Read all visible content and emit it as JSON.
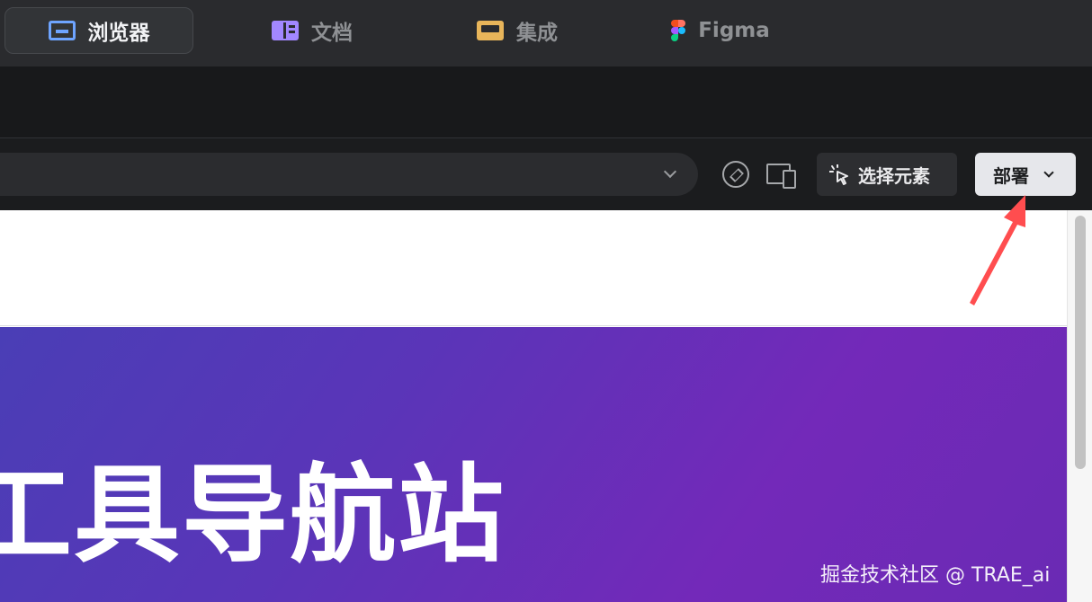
{
  "tabs": [
    {
      "label": "浏览器",
      "icon": "browser-icon",
      "active": true
    },
    {
      "label": "文档",
      "icon": "docs-icon",
      "active": false
    },
    {
      "label": "集成",
      "icon": "integration-icon",
      "active": false
    },
    {
      "label": "Figma",
      "icon": "figma-icon",
      "active": false
    }
  ],
  "toolbar": {
    "url_value": "",
    "select_element_label": "选择元素",
    "deploy_label": "部署"
  },
  "page": {
    "hero_title": "工具导航站"
  },
  "watermark": "掘金技术社区 @ TRAE_ai",
  "colors": {
    "accent_browser": "#6ea4ff",
    "accent_docs": "#a287ff",
    "accent_integration": "#e8b55a",
    "annotation_arrow": "#ff4d4f",
    "hero_gradient_start": "#4a3eb6",
    "hero_gradient_end": "#7329b9"
  }
}
